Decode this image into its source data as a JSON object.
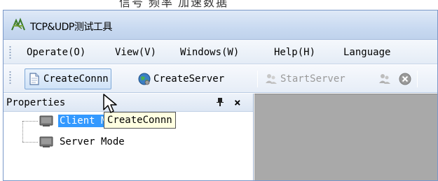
{
  "window": {
    "cropped_top_text": "信号 频率    加速数据",
    "title": "TCP&UDP测试工具"
  },
  "menu": {
    "items": [
      {
        "label": "Operate(O)"
      },
      {
        "label": "View(V)"
      },
      {
        "label": "Windows(W)"
      },
      {
        "label": "Help(H)"
      },
      {
        "label": "Language"
      }
    ]
  },
  "toolbar": {
    "create_conn": "CreateConnn",
    "create_server": "CreateServer",
    "start_server": "StartServer"
  },
  "properties_panel": {
    "title": "Properties",
    "pin_glyph": "ᵠ",
    "close_glyph": "×",
    "tree": [
      {
        "label": "Client Mode",
        "selected": true
      },
      {
        "label": "Server Mode",
        "selected": false
      }
    ]
  },
  "tooltip": {
    "text": "CreateConnn"
  },
  "colors": {
    "selection": "#3399ff",
    "workspace": "#a9a9a9",
    "tooltip_bg": "#ffffe1"
  }
}
